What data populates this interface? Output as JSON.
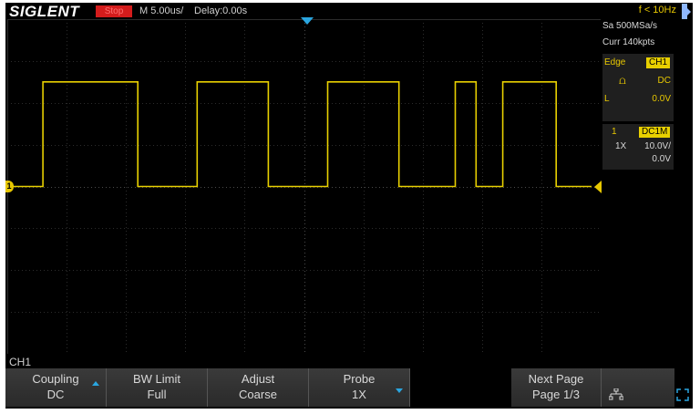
{
  "topbar": {
    "brand": "SIGLENT",
    "run_state": "Stop",
    "timebase": "M 5.00us/",
    "delay": "Delay:0.00s",
    "frequency": "f < 10Hz"
  },
  "acquisition": {
    "sample_rate": "Sa 500MSa/s",
    "memory": "Curr 140kpts"
  },
  "trigger": {
    "type": "Edge",
    "source": "CH1",
    "coupling": "DC",
    "level_label": "L",
    "level": "0.0V"
  },
  "channel": {
    "number": "1",
    "input": "DC1M",
    "probe": "1X",
    "scale": "10.0V/",
    "offset": "0.0V",
    "marker": "1"
  },
  "menu": {
    "title": "CH1",
    "buttons": [
      {
        "line1": "Coupling",
        "line2": "DC"
      },
      {
        "line1": "BW Limit",
        "line2": "Full"
      },
      {
        "line1": "Adjust",
        "line2": "Coarse"
      },
      {
        "line1": "Probe",
        "line2": "1X"
      },
      {
        "line1": "Next Page",
        "line2": "Page 1/3"
      }
    ]
  },
  "colors": {
    "trace": "#e8d000",
    "accent": "#2aa6e0",
    "stop": "#d41c1c"
  },
  "waveform": {
    "high_level_div": 2.5,
    "low_level_div": 0,
    "transitions_div": [
      0.6,
      2.2,
      3.2,
      4.4,
      5.4,
      6.6,
      7.55,
      7.9,
      8.35,
      9.25
    ]
  }
}
